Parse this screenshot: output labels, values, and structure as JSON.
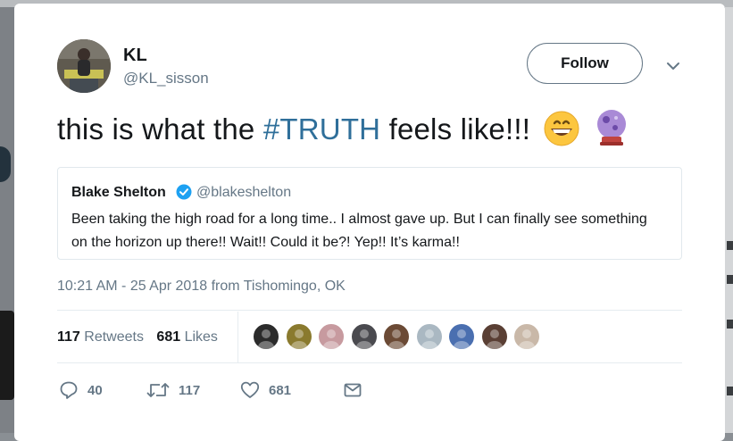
{
  "colors": {
    "hashtag": "#2f6f9a",
    "secondary_text": "#657786",
    "verified_badge": "#1da1f2",
    "border": "#e1e8ed"
  },
  "tweet": {
    "author": {
      "name": "KL",
      "handle": "@KL_sisson",
      "avatar_icon": "user-avatar-photo"
    },
    "follow_label": "Follow",
    "more_icon": "chevron-down-icon",
    "text_before": "this is what the ",
    "hashtag": "#TRUTH",
    "text_after": " feels like!!!",
    "emojis": [
      "grinning-face-emoji",
      "crystal-ball-emoji"
    ],
    "quoted": {
      "name": "Blake Shelton",
      "verified_icon": "verified-badge-icon",
      "handle": "@blakeshelton",
      "text": "Been taking the high road for a long time.. I almost gave up.  But I can finally see something on the horizon up there!! Wait!! Could it be?! Yep!! It’s karma!!"
    },
    "timestamp": "10:21 AM - 25 Apr 2018 from Tishomingo, OK",
    "stats": {
      "retweets_count": "117",
      "retweets_label": "Retweets",
      "likes_count": "681",
      "likes_label": "Likes"
    },
    "likers": [
      {
        "icon": "liker-avatar",
        "color": "#2b2b2b"
      },
      {
        "icon": "liker-avatar",
        "color": "#8a7a2e"
      },
      {
        "icon": "liker-avatar",
        "color": "#c79a9f"
      },
      {
        "icon": "liker-avatar",
        "color": "#4a4a4f"
      },
      {
        "icon": "liker-avatar",
        "color": "#6b4a35"
      },
      {
        "icon": "liker-avatar-default",
        "color": "#aab8c2"
      },
      {
        "icon": "liker-avatar",
        "color": "#4a6fb0"
      },
      {
        "icon": "liker-avatar",
        "color": "#5a3f34"
      },
      {
        "icon": "liker-avatar",
        "color": "#c9b8a8"
      }
    ],
    "actions": {
      "reply_count": "40",
      "retweet_count": "117",
      "like_count": "681"
    }
  }
}
